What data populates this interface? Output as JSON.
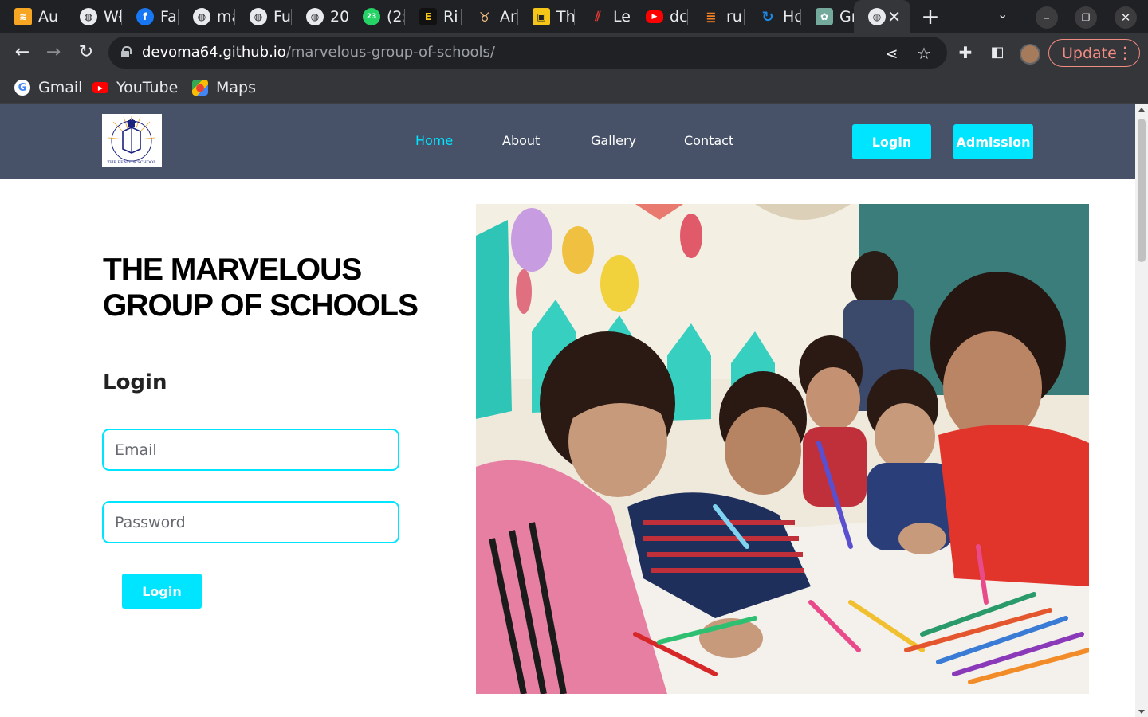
{
  "browser": {
    "tabs": [
      {
        "label": "Au",
        "icon": "stack-icon",
        "color": "#f6a623"
      },
      {
        "label": "Wł",
        "icon": "globe-icon",
        "color": "#e8eaed"
      },
      {
        "label": "Fa",
        "icon": "facebook-icon",
        "color": "#1877f2"
      },
      {
        "label": "ma",
        "icon": "globe-icon",
        "color": "#e8eaed"
      },
      {
        "label": "Fu",
        "icon": "globe-icon",
        "color": "#e8eaed"
      },
      {
        "label": "20",
        "icon": "globe-icon",
        "color": "#e8eaed"
      },
      {
        "label": "(2:",
        "icon": "whatsapp-icon",
        "color": "#25d366"
      },
      {
        "label": "Ri",
        "icon": "app-icon",
        "color": "#f5c518"
      },
      {
        "label": "Ar",
        "icon": "fox-icon",
        "color": "#f0c080"
      },
      {
        "label": "Th",
        "icon": "app-icon",
        "color": "#f5c518"
      },
      {
        "label": "Le",
        "icon": "slash-icon",
        "color": "#e53935"
      },
      {
        "label": "dc",
        "icon": "youtube-icon",
        "color": "#ff0000"
      },
      {
        "label": "ru",
        "icon": "stackoverflow-icon",
        "color": "#f48024"
      },
      {
        "label": "Ho",
        "icon": "refresh-icon",
        "color": "#1e88e5"
      },
      {
        "label": "Gr",
        "icon": "chatgpt-icon",
        "color": "#74aa9c"
      }
    ],
    "active_tab_icon": "globe-icon",
    "update_label": "Update",
    "url_host": "devoma64.github.io",
    "url_path": "/marvelous-group-of-schools/",
    "bookmarks": [
      {
        "label": "Gmail",
        "icon": "google-icon",
        "color": "#4285f4"
      },
      {
        "label": "YouTube",
        "icon": "youtube-icon",
        "color": "#ff0000"
      },
      {
        "label": "Maps",
        "icon": "maps-icon",
        "color": "#34a853"
      }
    ]
  },
  "site": {
    "logo_text": "THE BEACON SCHOOL",
    "nav": {
      "links": [
        {
          "label": "Home",
          "active": true
        },
        {
          "label": "About",
          "active": false
        },
        {
          "label": "Gallery",
          "active": false
        },
        {
          "label": "Contact",
          "active": false
        }
      ],
      "login_label": "Login",
      "admission_label": "Admission"
    },
    "hero": {
      "title": "THE MARVELOUS GROUP OF SCHOOLS",
      "login_heading": "Login",
      "email_placeholder": "Email",
      "password_placeholder": "Password",
      "submit_label": "Login"
    },
    "colors": {
      "nav_bg": "#475269",
      "accent": "#00e5ff"
    }
  }
}
